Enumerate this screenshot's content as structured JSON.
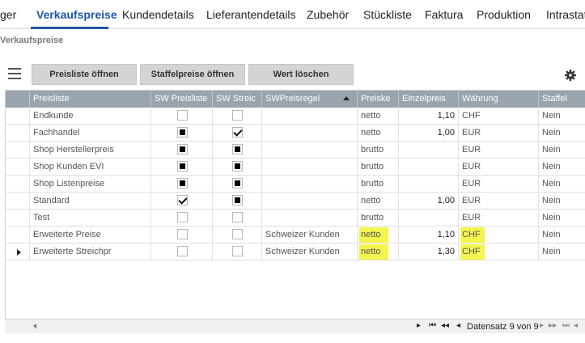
{
  "tabs": [
    {
      "label": "ger",
      "active": false
    },
    {
      "label": "Verkaufspreise",
      "active": true
    },
    {
      "label": "Kundendetails",
      "active": false
    },
    {
      "label": "Lieferantendetails",
      "active": false
    },
    {
      "label": "Zubehör",
      "active": false
    },
    {
      "label": "Stückliste",
      "active": false
    },
    {
      "label": "Faktura",
      "active": false
    },
    {
      "label": "Produktion",
      "active": false
    },
    {
      "label": "Intrastat",
      "active": false
    }
  ],
  "section_title": "Verkaufspreise",
  "toolbar": {
    "menu_icon": "hamburger-icon",
    "buttons": [
      "Preisliste öffnen",
      "Staffelpreise öffnen",
      "Wert löschen"
    ],
    "settings_icon": "gear-icon"
  },
  "grid": {
    "columns": [
      "Preisliste",
      "SW Preisliste",
      "SW Streic",
      "SWPreisregel",
      "Preiske",
      "Einzelpreis",
      "Währung",
      "Staffel"
    ],
    "sort": {
      "column": "SWPreisregel",
      "direction": "ascending"
    },
    "rows": [
      {
        "preisliste": "Endkunde",
        "sw_preisliste": "empty",
        "sw_streic": "empty",
        "swpreisregel": "",
        "preiskennz": "netto",
        "einzelpreis": "1,10",
        "waehrung": "CHF",
        "staffel": "Nein",
        "highlight": false,
        "current": false
      },
      {
        "preisliste": "Fachhandel",
        "sw_preisliste": "filled",
        "sw_streic": "checked",
        "swpreisregel": "",
        "preiskennz": "netto",
        "einzelpreis": "1,00",
        "waehrung": "EUR",
        "staffel": "Nein",
        "highlight": false,
        "current": false
      },
      {
        "preisliste": "Shop Herstellerpreis",
        "sw_preisliste": "filled",
        "sw_streic": "filled",
        "swpreisregel": "",
        "preiskennz": "brutto",
        "einzelpreis": "",
        "waehrung": "EUR",
        "staffel": "Nein",
        "highlight": false,
        "current": false
      },
      {
        "preisliste": "Shop Kunden EVI",
        "sw_preisliste": "filled",
        "sw_streic": "filled",
        "swpreisregel": "",
        "preiskennz": "brutto",
        "einzelpreis": "",
        "waehrung": "EUR",
        "staffel": "Nein",
        "highlight": false,
        "current": false
      },
      {
        "preisliste": "Shop Listenpreise",
        "sw_preisliste": "filled",
        "sw_streic": "filled",
        "swpreisregel": "",
        "preiskennz": "brutto",
        "einzelpreis": "",
        "waehrung": "EUR",
        "staffel": "Nein",
        "highlight": false,
        "current": false
      },
      {
        "preisliste": "Standard",
        "sw_preisliste": "checked",
        "sw_streic": "filled",
        "swpreisregel": "",
        "preiskennz": "netto",
        "einzelpreis": "1,00",
        "waehrung": "EUR",
        "staffel": "Nein",
        "highlight": false,
        "current": false
      },
      {
        "preisliste": "Test",
        "sw_preisliste": "empty",
        "sw_streic": "empty",
        "swpreisregel": "",
        "preiskennz": "brutto",
        "einzelpreis": "",
        "waehrung": "EUR",
        "staffel": "Nein",
        "highlight": false,
        "current": false
      },
      {
        "preisliste": "Erweiterte Preise",
        "sw_preisliste": "empty",
        "sw_streic": "empty",
        "swpreisregel": "Schweizer Kunden",
        "preiskennz": "netto",
        "einzelpreis": "1,10",
        "waehrung": "CHF",
        "staffel": "Nein",
        "highlight": true,
        "current": false
      },
      {
        "preisliste": "Erweiterte Streichpr",
        "sw_preisliste": "empty",
        "sw_streic": "empty",
        "swpreisregel": "Schweizer Kunden",
        "preiskennz": "netto",
        "einzelpreis": "1,30",
        "waehrung": "CHF",
        "staffel": "Nein",
        "highlight": true,
        "current": true
      }
    ]
  },
  "navigator": {
    "status": "Datensatz 9 von 9"
  },
  "colors": {
    "accent": "#1e56a8",
    "header_bg": "#9aa4ad",
    "highlight": "#f4f54f",
    "button_bg": "#d4d4d4"
  }
}
